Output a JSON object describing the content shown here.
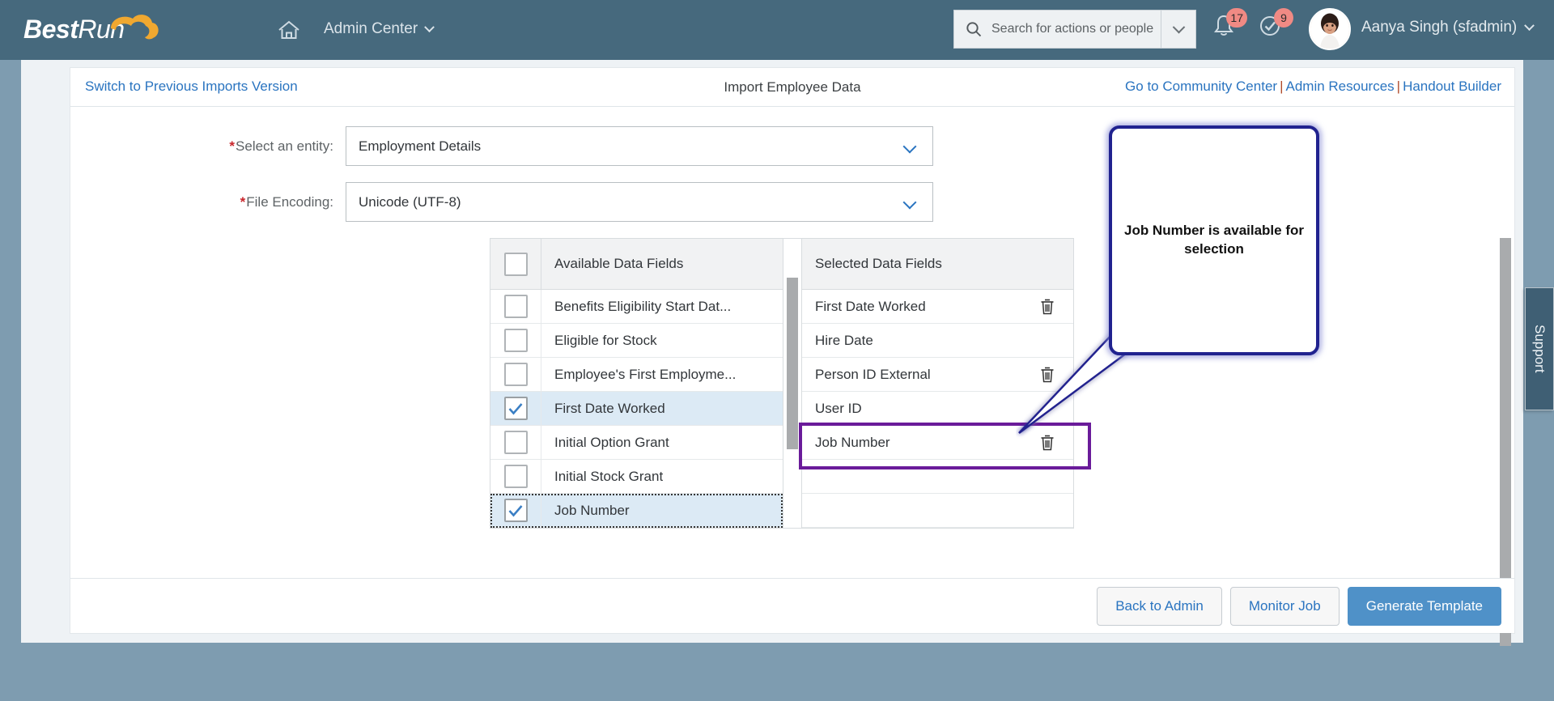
{
  "header": {
    "logo_bold": "Best",
    "logo_light": "Run",
    "home_icon": "home-icon",
    "nav_label": "Admin Center",
    "search": {
      "placeholder": "Search for actions or people",
      "value": "",
      "icon": "search-icon",
      "dropdown_icon": "chevron-down-icon"
    },
    "notifications": {
      "icon": "bell-icon",
      "badge": "17"
    },
    "todos": {
      "icon": "check-circle-icon",
      "badge": "9"
    },
    "user": {
      "name": "Aanya Singh (sfadmin)",
      "avatar": "avatar",
      "menu_icon": "chevron-down-icon"
    }
  },
  "linkbar": {
    "switch_version": "Switch to Previous Imports Version",
    "title": "Import Employee Data",
    "community_center": "Go to Community Center",
    "admin_resources": "Admin Resources",
    "handout_builder": "Handout Builder",
    "separator": "|"
  },
  "form": {
    "entity": {
      "label": "Select an entity:",
      "value": "Employment Details",
      "required": true
    },
    "encoding": {
      "label": "File Encoding:",
      "value": "Unicode (UTF-8)",
      "required": true
    }
  },
  "dual_list": {
    "available_header": "Available Data Fields",
    "selected_header": "Selected Data Fields",
    "select_all_checked": false,
    "available": [
      {
        "label": "Benefits Eligibility Start Dat...",
        "checked": false,
        "selected": false,
        "focused": false
      },
      {
        "label": "Eligible for Stock",
        "checked": false,
        "selected": false,
        "focused": false
      },
      {
        "label": "Employee's First Employme...",
        "checked": false,
        "selected": false,
        "focused": false
      },
      {
        "label": "First Date Worked",
        "checked": true,
        "selected": true,
        "focused": false
      },
      {
        "label": "Initial Option Grant",
        "checked": false,
        "selected": false,
        "focused": false
      },
      {
        "label": "Initial Stock Grant",
        "checked": false,
        "selected": false,
        "focused": false
      },
      {
        "label": "Job Number",
        "checked": true,
        "selected": true,
        "focused": true
      }
    ],
    "selected": [
      {
        "label": "First Date Worked",
        "deletable": true,
        "highlighted": false
      },
      {
        "label": "Hire Date",
        "deletable": false,
        "highlighted": false
      },
      {
        "label": "Person ID External",
        "deletable": true,
        "highlighted": false
      },
      {
        "label": "User ID",
        "deletable": false,
        "highlighted": false
      },
      {
        "label": "Job Number",
        "deletable": true,
        "highlighted": true
      },
      {
        "label": "",
        "deletable": false,
        "highlighted": false
      },
      {
        "label": "",
        "deletable": false,
        "highlighted": false
      }
    ]
  },
  "callout": {
    "text": "Job Number is available for selection"
  },
  "actions": {
    "back_to_admin": "Back to Admin",
    "monitor_job": "Monitor Job",
    "generate_template": "Generate Template"
  },
  "support_tab": {
    "label": "Support"
  },
  "colors": {
    "header_bg": "#46697d",
    "page_bg": "#7e9cb0",
    "accent_blue": "#2a74c0",
    "primary_button": "#4f91c8",
    "required_star": "#c8252b",
    "badge_red": "#f08a84",
    "highlight_purple": "#6a1b9a",
    "callout_border": "#20228f",
    "row_selected": "#dceaf5"
  }
}
